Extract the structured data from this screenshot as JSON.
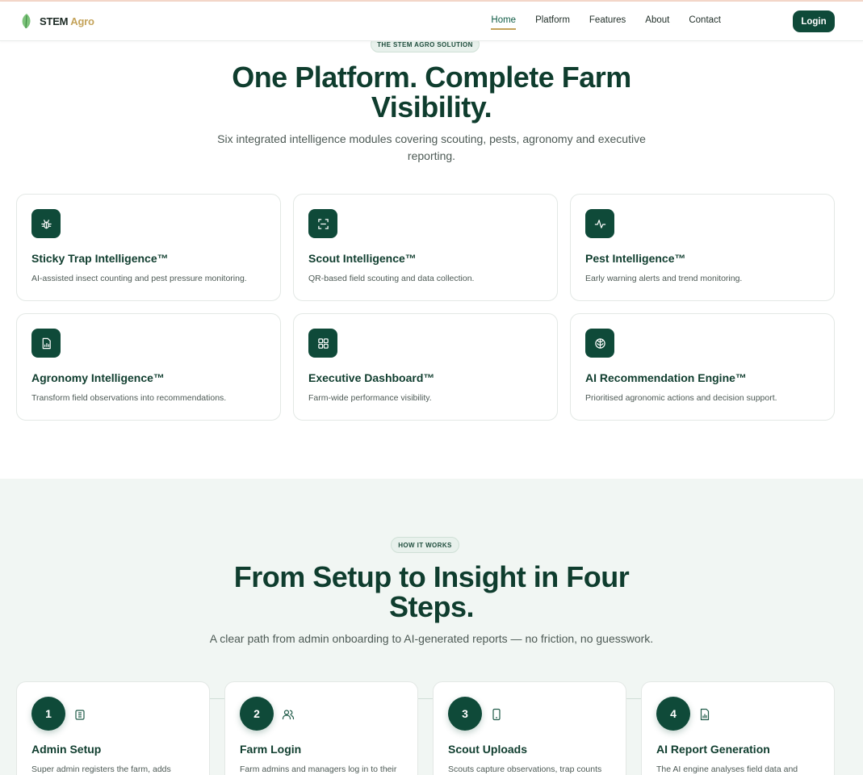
{
  "brand": {
    "name": "STEM",
    "accent": "Agro"
  },
  "nav": {
    "links": [
      "Home",
      "Platform",
      "Features",
      "About",
      "Contact"
    ],
    "active": "Home",
    "login_label": "Login"
  },
  "solution": {
    "pill": "THE STEM AGRO SOLUTION",
    "title_line1": "One Platform. Complete Farm",
    "title_line2": "Visibility.",
    "subtitle_line1": "Six integrated intelligence modules covering scouting, pests, agronomy and executive",
    "subtitle_line2": "reporting.",
    "modules": [
      {
        "icon": "bug-icon",
        "title": "Sticky Trap Intelligence™",
        "desc": "AI-assisted insect counting and pest pressure monitoring."
      },
      {
        "icon": "scan-icon",
        "title": "Scout Intelligence™",
        "desc": "QR-based field scouting and data collection."
      },
      {
        "icon": "activity-icon",
        "title": "Pest Intelligence™",
        "desc": "Early warning alerts and trend monitoring."
      },
      {
        "icon": "report-icon",
        "title": "Agronomy Intelligence™",
        "desc": "Transform field observations into recommendations."
      },
      {
        "icon": "dashboard-icon",
        "title": "Executive Dashboard™",
        "desc": "Farm-wide performance visibility."
      },
      {
        "icon": "brain-icon",
        "title": "AI Recommendation Engine™",
        "desc": "Prioritised agronomic actions and decision support."
      }
    ]
  },
  "how": {
    "pill": "HOW IT WORKS",
    "title_line1": "From Setup to Insight in Four",
    "title_line2": "Steps.",
    "subtitle": "A clear path from admin onboarding to AI-generated reports — no friction, no guesswork.",
    "steps": [
      {
        "num": "1",
        "icon": "building-icon",
        "title": "Admin Setup",
        "desc": "Super admin registers the farm, adds"
      },
      {
        "num": "2",
        "icon": "users-icon",
        "title": "Farm Login",
        "desc": "Farm admins and managers log in to their"
      },
      {
        "num": "3",
        "icon": "phone-icon",
        "title": "Scout Uploads",
        "desc": "Scouts capture observations, trap counts"
      },
      {
        "num": "4",
        "icon": "file-chart-icon",
        "title": "AI Report Generation",
        "desc": "The AI engine analyses field data and"
      }
    ]
  },
  "colors": {
    "primary": "#0f4a39",
    "accent": "#c4a35a",
    "section_bg": "#f1f6f3"
  }
}
